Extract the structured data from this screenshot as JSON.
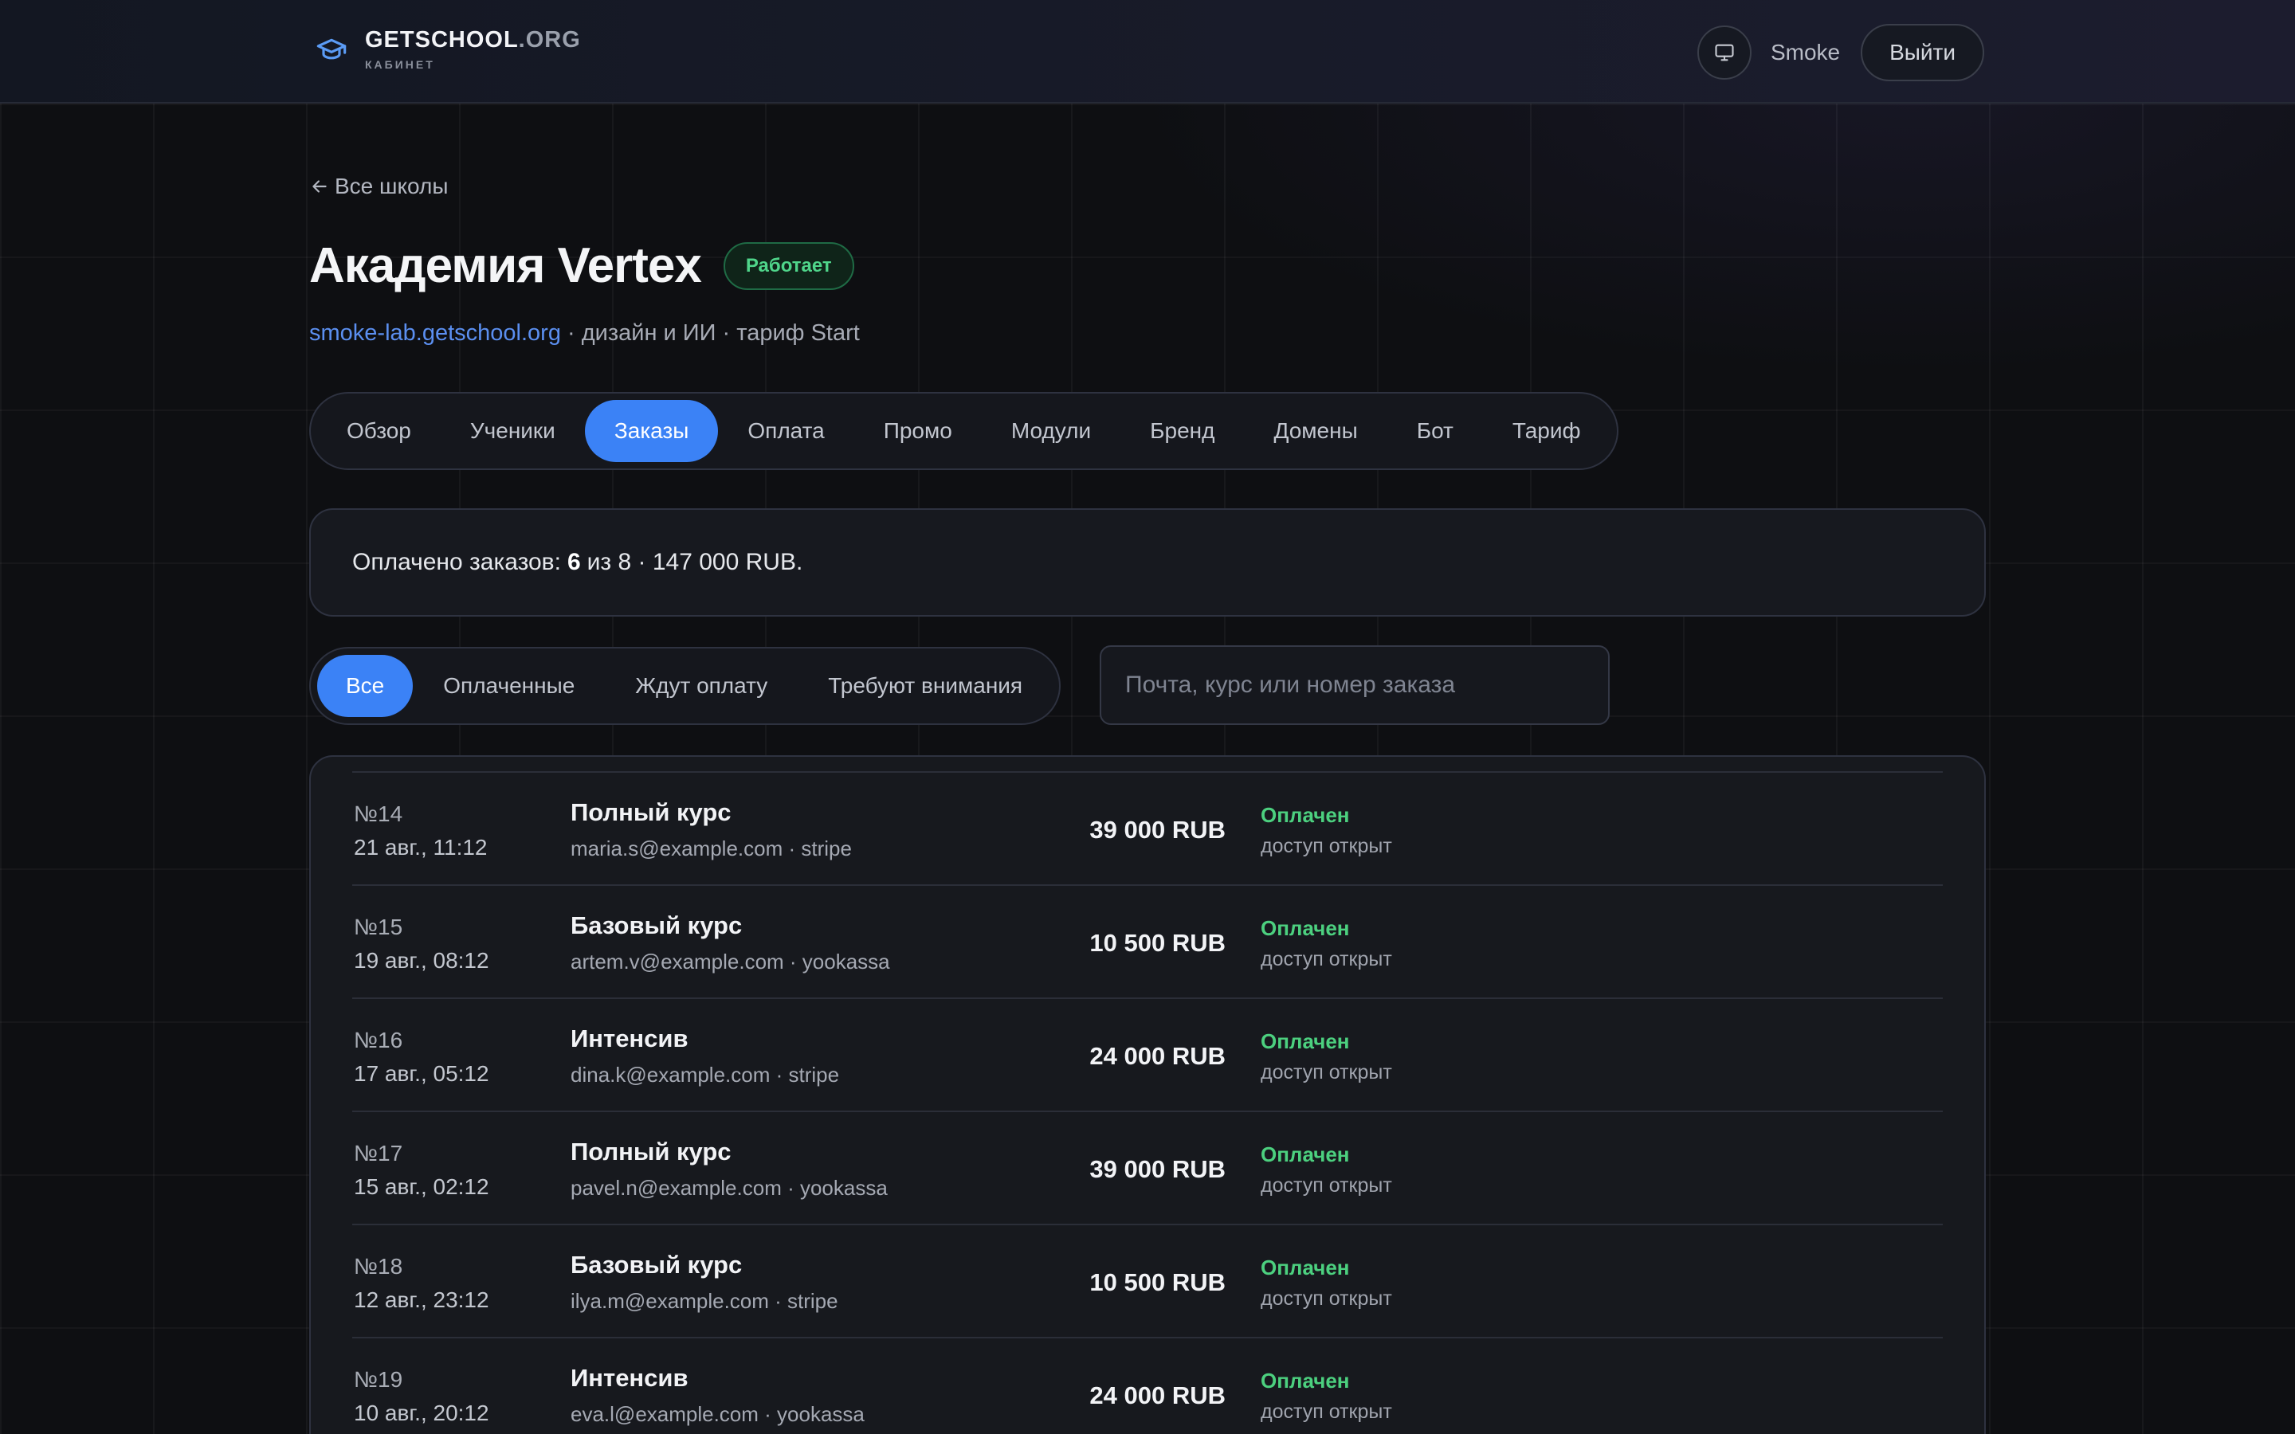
{
  "header": {
    "brand_name": "GETSCHOOL",
    "brand_tld": ".ORG",
    "brand_sub": "КАБИНЕТ",
    "user_name": "Smoke",
    "logout_label": "Выйти"
  },
  "back_link": "Все школы",
  "school": {
    "title": "Академия Vertex",
    "status": "Работает",
    "domain": "smoke-lab.getschool.org",
    "details": " · дизайн и ИИ · тариф Start"
  },
  "tabs": [
    {
      "label": "Обзор"
    },
    {
      "label": "Ученики"
    },
    {
      "label": "Заказы"
    },
    {
      "label": "Оплата"
    },
    {
      "label": "Промо"
    },
    {
      "label": "Модули"
    },
    {
      "label": "Бренд"
    },
    {
      "label": "Домены"
    },
    {
      "label": "Бот"
    },
    {
      "label": "Тариф"
    }
  ],
  "summary": {
    "prefix": "Оплачено заказов:",
    "paid": "6",
    "rest": "из 8 · 147 000 RUB."
  },
  "filters": [
    {
      "label": "Все"
    },
    {
      "label": "Оплаченные"
    },
    {
      "label": "Ждут оплату"
    },
    {
      "label": "Требуют внимания"
    }
  ],
  "search": {
    "placeholder": "Почта, курс или номер заказа",
    "value": ""
  },
  "orders": [
    {
      "number": "№14",
      "date": "21 авг., 11:12",
      "course": "Полный курс",
      "meta": "maria.s@example.com · stripe",
      "amount": "39 000 RUB",
      "status": "Оплачен",
      "access": "доступ открыт"
    },
    {
      "number": "№15",
      "date": "19 авг., 08:12",
      "course": "Базовый курс",
      "meta": "artem.v@example.com · yookassa",
      "amount": "10 500 RUB",
      "status": "Оплачен",
      "access": "доступ открыт"
    },
    {
      "number": "№16",
      "date": "17 авг., 05:12",
      "course": "Интенсив",
      "meta": "dina.k@example.com · stripe",
      "amount": "24 000 RUB",
      "status": "Оплачен",
      "access": "доступ открыт"
    },
    {
      "number": "№17",
      "date": "15 авг., 02:12",
      "course": "Полный курс",
      "meta": "pavel.n@example.com · yookassa",
      "amount": "39 000 RUB",
      "status": "Оплачен",
      "access": "доступ открыт"
    },
    {
      "number": "№18",
      "date": "12 авг., 23:12",
      "course": "Базовый курс",
      "meta": "ilya.m@example.com · stripe",
      "amount": "10 500 RUB",
      "status": "Оплачен",
      "access": "доступ открыт"
    },
    {
      "number": "№19",
      "date": "10 авг., 20:12",
      "course": "Интенсив",
      "meta": "eva.l@example.com · yookassa",
      "amount": "24 000 RUB",
      "status": "Оплачен",
      "access": "доступ открыт"
    }
  ],
  "colors": {
    "accent": "#3b82f6",
    "paid": "#4cd07f",
    "link": "#5b8ff0",
    "background": "#0e0f12"
  },
  "icons": {
    "brand": "graduation-cap-icon",
    "theme": "monitor-icon",
    "back": "arrow-left-icon"
  }
}
